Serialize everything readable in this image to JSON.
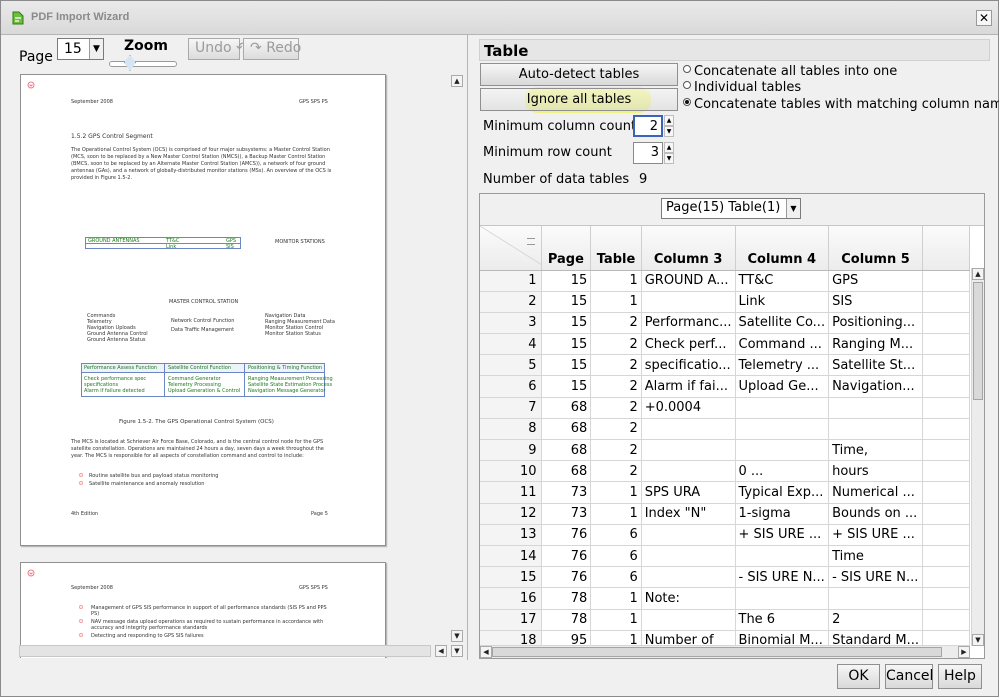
{
  "window": {
    "title": "PDF Import Wizard",
    "close_glyph": "✕"
  },
  "left": {
    "page_label": "Page",
    "page_value": "15",
    "zoom_label": "Zoom",
    "undo_label": "Undo",
    "redo_label": "Redo",
    "preview1": {
      "header_left": "September 2008",
      "header_right": "GPS SPS PS",
      "section_heading": "1.5.2  GPS Control Segment",
      "para1": "The Operational Control System (OCS) is comprised of four major subsystems: a Master Control Station (MCS, soon to be replaced by a New Master Control Station (NMCS)), a Backup Master Control Station (BMCS, soon to be replaced by an Alternate Master Control Station (AMCS)), a network of four ground antennas (GAs), and a network of globally-distributed monitor stations (MSs). An overview of the OCS is provided in Figure 1.5-2.",
      "diagram_table1": [
        "GROUND ANTENNAS",
        "TT&C",
        "GPS"
      ],
      "diagram_row2": [
        "Link",
        "SIS"
      ],
      "monitor_stations": "MONITOR STATIONS",
      "master_control": "MASTER CONTROL STATION",
      "left_list": [
        "Commands",
        "Telemetry",
        "Navigation Uploads",
        "Ground Antenna Control",
        "Ground Antenna Status"
      ],
      "mid_list": [
        "Network Control Function",
        "Data Traffic Management"
      ],
      "right_list": [
        "Navigation Data",
        "Ranging Measurement Data",
        "Monitor Station Control",
        "Monitor Station Status"
      ],
      "func_table_head": [
        "Performance Assess Function",
        "Satellite Control Function",
        "Positioning & Timing Function"
      ],
      "func_table_rows": [
        [
          "Check performance spec",
          "Command Generator",
          "Ranging Measurement Processing"
        ],
        [
          "specifications",
          "Telemetry Processing",
          "Satellite State Estimation Process"
        ],
        [
          "Alarm if failure detected",
          "Upload Generation & Control",
          "Navigation Message Generator"
        ]
      ],
      "caption": "Figure 1.5-2.  The GPS Operational Control System (OCS)",
      "para2": "The MCS is located at Schriever Air Force Base, Colorado, and is the central control node for the GPS satellite constellation. Operations are maintained 24 hours a day, seven days a week throughout the year. The MCS is responsible for all aspects of constellation command and control to include:",
      "bullets": [
        "Routine satellite bus and payload status monitoring",
        "Satellite maintenance and anomaly resolution"
      ],
      "footer_left": "4th Edition",
      "footer_right": "Page 5"
    },
    "preview2": {
      "header_left": "September 2008",
      "header_right": "GPS SPS PS",
      "bullets": [
        "Management of GPS SIS performance in support of all performance standards (SIS PS and PPS PS)",
        "NAV message data upload operations as required to sustain performance in accordance with accuracy and integrity performance standards",
        "Detecting and responding to GPS SIS failures"
      ]
    }
  },
  "right": {
    "section_title": "Table",
    "autodetect_label": "Auto-detect tables",
    "ignoreall_label": "Ignore all tables",
    "radio_options": [
      {
        "label": "Concatenate all tables into one",
        "selected": false
      },
      {
        "label": "Individual tables",
        "selected": false
      },
      {
        "label": "Concatenate tables with matching column names",
        "selected": true
      }
    ],
    "min_col_label": "Minimum column count",
    "min_col_value": "2",
    "min_row_label": "Minimum row count",
    "min_row_value": "3",
    "num_tables_label": "Number of data tables",
    "num_tables_value": "9",
    "table_select_value": "Page(15)  Table(1)",
    "highlight_color": "#eef55a",
    "columns": [
      "Page",
      "Table",
      "Column 3",
      "Column 4",
      "Column 5"
    ],
    "rows": [
      [
        "1",
        "15",
        "1",
        "GROUND A...",
        "TT&C",
        "GPS"
      ],
      [
        "2",
        "15",
        "1",
        "",
        "Link",
        "SIS"
      ],
      [
        "3",
        "15",
        "2",
        "Performanc...",
        "Satellite Co...",
        "Positioning..."
      ],
      [
        "4",
        "15",
        "2",
        " Check perf...",
        " Command ...",
        " Ranging M..."
      ],
      [
        "5",
        "15",
        "2",
        "specificatio...",
        " Telemetry ...",
        " Satellite St..."
      ],
      [
        "6",
        "15",
        "2",
        " Alarm if fai...",
        " Upload Ge...",
        " Navigation..."
      ],
      [
        "7",
        "68",
        "2",
        "+0.0004",
        "",
        ""
      ],
      [
        "8",
        "68",
        "2",
        "",
        "",
        ""
      ],
      [
        "9",
        "68",
        "2",
        "",
        "",
        " Time,"
      ],
      [
        "10",
        "68",
        "2",
        "",
        "0         ...",
        " hours"
      ],
      [
        "11",
        "73",
        "1",
        "SPS URA",
        "Typical Exp...",
        "Numerical ..."
      ],
      [
        "12",
        "73",
        "1",
        "Index \"N\"",
        "1-sigma",
        "Bounds on ..."
      ],
      [
        "13",
        "76",
        "6",
        "",
        "+ SIS URE ...",
        "+ SIS URE ..."
      ],
      [
        "14",
        "76",
        "6",
        "",
        "",
        "Time"
      ],
      [
        "15",
        "76",
        "6",
        "",
        "- SIS URE N...",
        "- SIS URE N..."
      ],
      [
        "16",
        "78",
        "1",
        "Note:",
        "",
        ""
      ],
      [
        "17",
        "78",
        "1",
        "",
        "The 6",
        "2"
      ],
      [
        "18",
        "95",
        "1",
        "Number of",
        "Binomial M...",
        "Standard M..."
      ]
    ]
  },
  "footer": {
    "ok_label": "OK",
    "cancel_label": "Cancel",
    "help_label": "Help"
  }
}
